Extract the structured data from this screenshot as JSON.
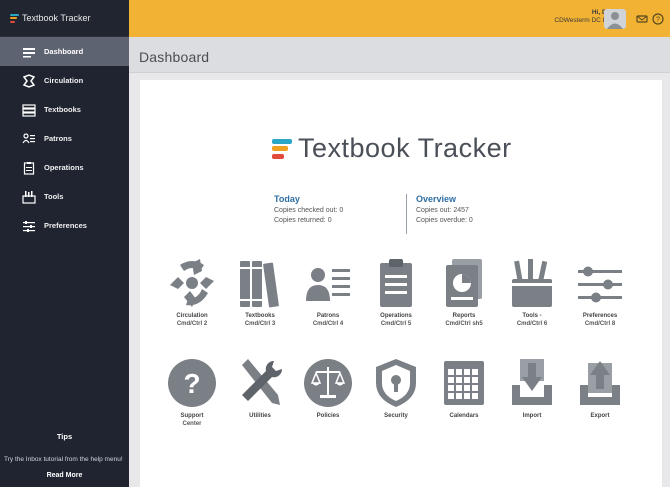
{
  "app": {
    "brand": "Textbook Tracker"
  },
  "sidebar": {
    "items": [
      {
        "label": "Dashboard",
        "icon": "dashboard-icon",
        "active": true
      },
      {
        "label": "Circulation",
        "icon": "circulation-icon"
      },
      {
        "label": "Textbooks",
        "icon": "textbooks-icon"
      },
      {
        "label": "Patrons",
        "icon": "patrons-icon"
      },
      {
        "label": "Operations",
        "icon": "operations-icon"
      },
      {
        "label": "Tools",
        "icon": "tools-icon"
      },
      {
        "label": "Preferences",
        "icon": "preferences-icon"
      }
    ],
    "tips": {
      "title": "Tips",
      "body": "Try the Inbox tutorial from the help menu!",
      "more": "Read More"
    }
  },
  "topbar": {
    "user_name": "Hi, Demo",
    "user_site": "CDWesterm DC Demo"
  },
  "header": {
    "title": "Dashboard"
  },
  "main": {
    "logo_text": "Textbook Tracker",
    "today": {
      "title": "Today",
      "checked_out": "Copies checked out: 0",
      "returned": "Copies returned: 0"
    },
    "overview": {
      "title": "Overview",
      "copies_out": "Copies out: 2457",
      "overdue": "Copies overdue: 0"
    },
    "tiles_row1": [
      {
        "label": "Circulation",
        "shortcut": "Cmd/Ctrl 2"
      },
      {
        "label": "Textbooks",
        "shortcut": "Cmd/Ctrl 3"
      },
      {
        "label": "Patrons",
        "shortcut": "Cmd/Ctrl 4"
      },
      {
        "label": "Operations",
        "shortcut": "Cmd/Ctrl 5"
      },
      {
        "label": "Reports",
        "shortcut": "Cmd/Ctrl sh5"
      },
      {
        "label": "Tools -",
        "shortcut": "Cmd/Ctrl 6"
      },
      {
        "label": "Preferences",
        "shortcut": "Cmd/Ctrl 8"
      }
    ],
    "tiles_row2": [
      {
        "label": "Support",
        "label2": "Center"
      },
      {
        "label": "Utilities"
      },
      {
        "label": "Policies"
      },
      {
        "label": "Security"
      },
      {
        "label": "Calendars"
      },
      {
        "label": "Import"
      },
      {
        "label": "Export"
      }
    ]
  },
  "colors": {
    "accent_yellow": "#f2b233",
    "sidebar_bg": "#1f2430",
    "icon_gray": "#7b7f86",
    "link_blue": "#2f6fa3",
    "logo_teal": "#2aa6c6",
    "logo_orange": "#f2a01f",
    "logo_red": "#e24b3a"
  }
}
